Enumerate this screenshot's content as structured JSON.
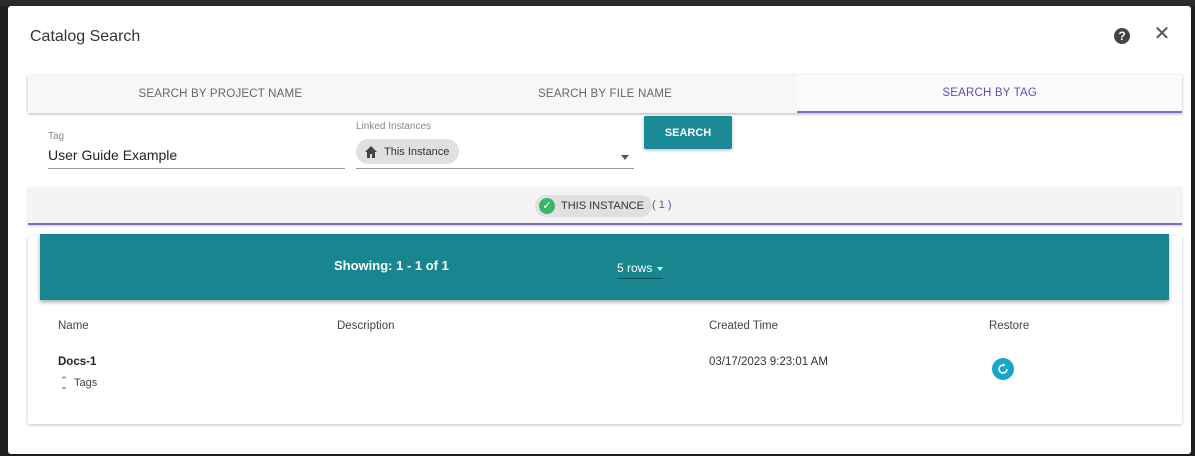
{
  "dialog": {
    "title": "Catalog Search",
    "help_icon": "?",
    "close_icon": "✕"
  },
  "tabs": [
    {
      "label": "SEARCH BY PROJECT NAME",
      "active": false
    },
    {
      "label": "SEARCH BY FILE NAME",
      "active": false
    },
    {
      "label": "SEARCH BY TAG",
      "active": true
    }
  ],
  "form": {
    "tag_label": "Tag",
    "tag_value": "User Guide Example",
    "linked_label": "Linked Instances",
    "linked_chip": "This Instance",
    "search_label": "SEARCH"
  },
  "instance_bar": {
    "chip_label": "THIS INSTANCE",
    "count": "( 1 )"
  },
  "results": {
    "showing": "Showing: 1 - 1 of 1",
    "rows_per_page": "5 rows",
    "columns": [
      "Name",
      "Description",
      "Created Time",
      "Restore"
    ],
    "rows": [
      {
        "name": "Docs-1",
        "description": "",
        "created": "03/17/2023 9:23:01 AM",
        "tags_label": "Tags"
      }
    ]
  },
  "colors": {
    "accent": "#19868f",
    "tab_active": "#5a4fb5",
    "restore": "#17a5c8",
    "check": "#3bb56a"
  }
}
